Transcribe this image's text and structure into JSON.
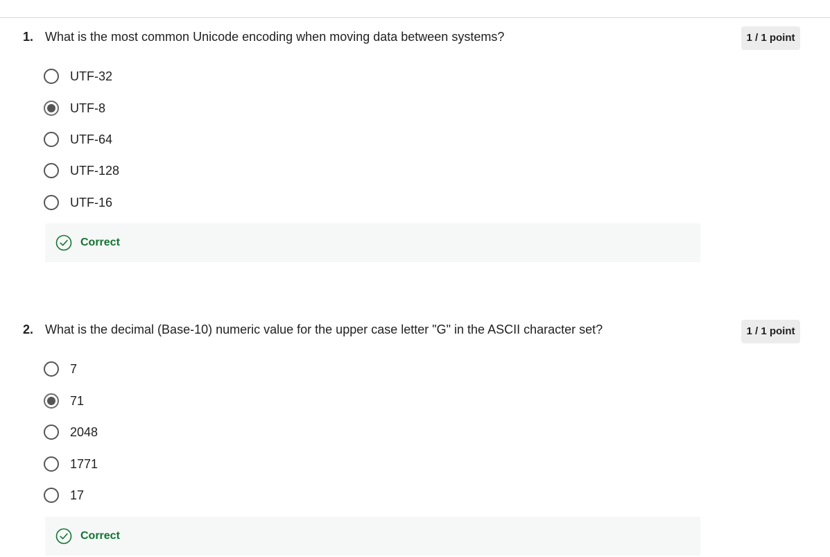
{
  "questions": [
    {
      "number": "1.",
      "text": "What is the most common Unicode encoding when moving data between systems?",
      "points": "1 / 1 point",
      "options": [
        {
          "label": "UTF-32",
          "selected": false
        },
        {
          "label": "UTF-8",
          "selected": true
        },
        {
          "label": "UTF-64",
          "selected": false
        },
        {
          "label": "UTF-128",
          "selected": false
        },
        {
          "label": "UTF-16",
          "selected": false
        }
      ],
      "feedback": "Correct"
    },
    {
      "number": "2.",
      "text": "What is the decimal (Base-10) numeric value for the upper case letter \"G\" in the ASCII character set?",
      "points": "1 / 1 point",
      "options": [
        {
          "label": "7",
          "selected": false
        },
        {
          "label": "71",
          "selected": true
        },
        {
          "label": "2048",
          "selected": false
        },
        {
          "label": "1771",
          "selected": false
        },
        {
          "label": "17",
          "selected": false
        }
      ],
      "feedback": "Correct"
    }
  ],
  "colors": {
    "correct_green": "#137333",
    "feedback_bg": "#f5f8f6",
    "badge_bg": "#ececec"
  },
  "icons": {
    "feedback": "check-circle-icon",
    "radio": "radio-icon"
  }
}
